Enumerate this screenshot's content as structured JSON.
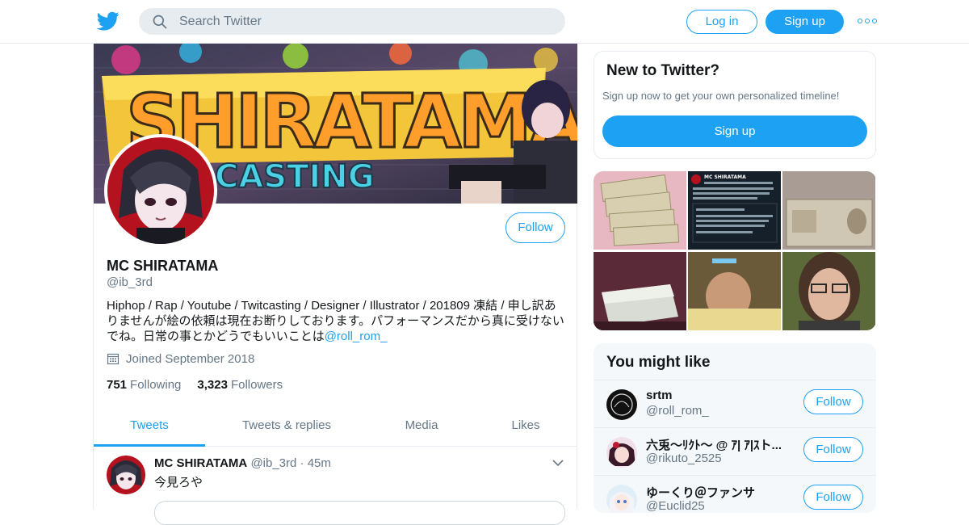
{
  "nav": {
    "logo_icon": "twitter-bird-icon",
    "search_placeholder": "Search Twitter",
    "login_label": "Log in",
    "signup_label": "Sign up",
    "more_icon": "more-dots-icon",
    "accent": "#1da1f2"
  },
  "profile": {
    "banner_text": "SHIRATAMA",
    "banner_subtext": "CASTING",
    "follow_label": "Follow",
    "name": "MC SHIRATAMA",
    "handle": "@ib_3rd",
    "bio_text": "Hiphop / Rap / Youtube /  Twitcasting / Designer / Illustrator / 201809 凍結 / 申し訳ありませんが絵の依頼は現在お断りしております。パフォーマンスだから真に受けないでね。日常の事とかどうでもいいことは",
    "bio_link": "@roll_rom_",
    "joined": "Joined September 2018",
    "following_count": "751",
    "following_label": "Following",
    "followers_count": "3,323",
    "followers_label": "Followers"
  },
  "tabs": [
    {
      "label": "Tweets",
      "active": true
    },
    {
      "label": "Tweets & replies",
      "active": false
    },
    {
      "label": "Media",
      "active": false
    },
    {
      "label": "Likes",
      "active": false
    }
  ],
  "tweet": {
    "name": "MC SHIRATAMA",
    "handle": "@ib_3rd",
    "separator": "·",
    "time": "45m",
    "text": "今見ろや"
  },
  "signup_card": {
    "title": "New to Twitter?",
    "subtitle": "Sign up now to get your own personalized timeline!",
    "button": "Sign up"
  },
  "media_grid": {
    "captions": [
      "",
      "",
      "",
      "",
      "",
      ""
    ],
    "tweet_snippet_name": "MC SHIRATAMA"
  },
  "you_might_like": {
    "title": "You might like",
    "users": [
      {
        "name": "srtm",
        "handle": "@roll_rom_",
        "follow": "Follow"
      },
      {
        "name": "六兎〜ﾘｸﾄ〜 @ ｱ| ｱ|ｽト...",
        "handle": "@rikuto_2525",
        "follow": "Follow"
      },
      {
        "name": "ゆーくり＠ファンサ",
        "handle": "@Euclid25",
        "follow": "Follow"
      }
    ]
  }
}
